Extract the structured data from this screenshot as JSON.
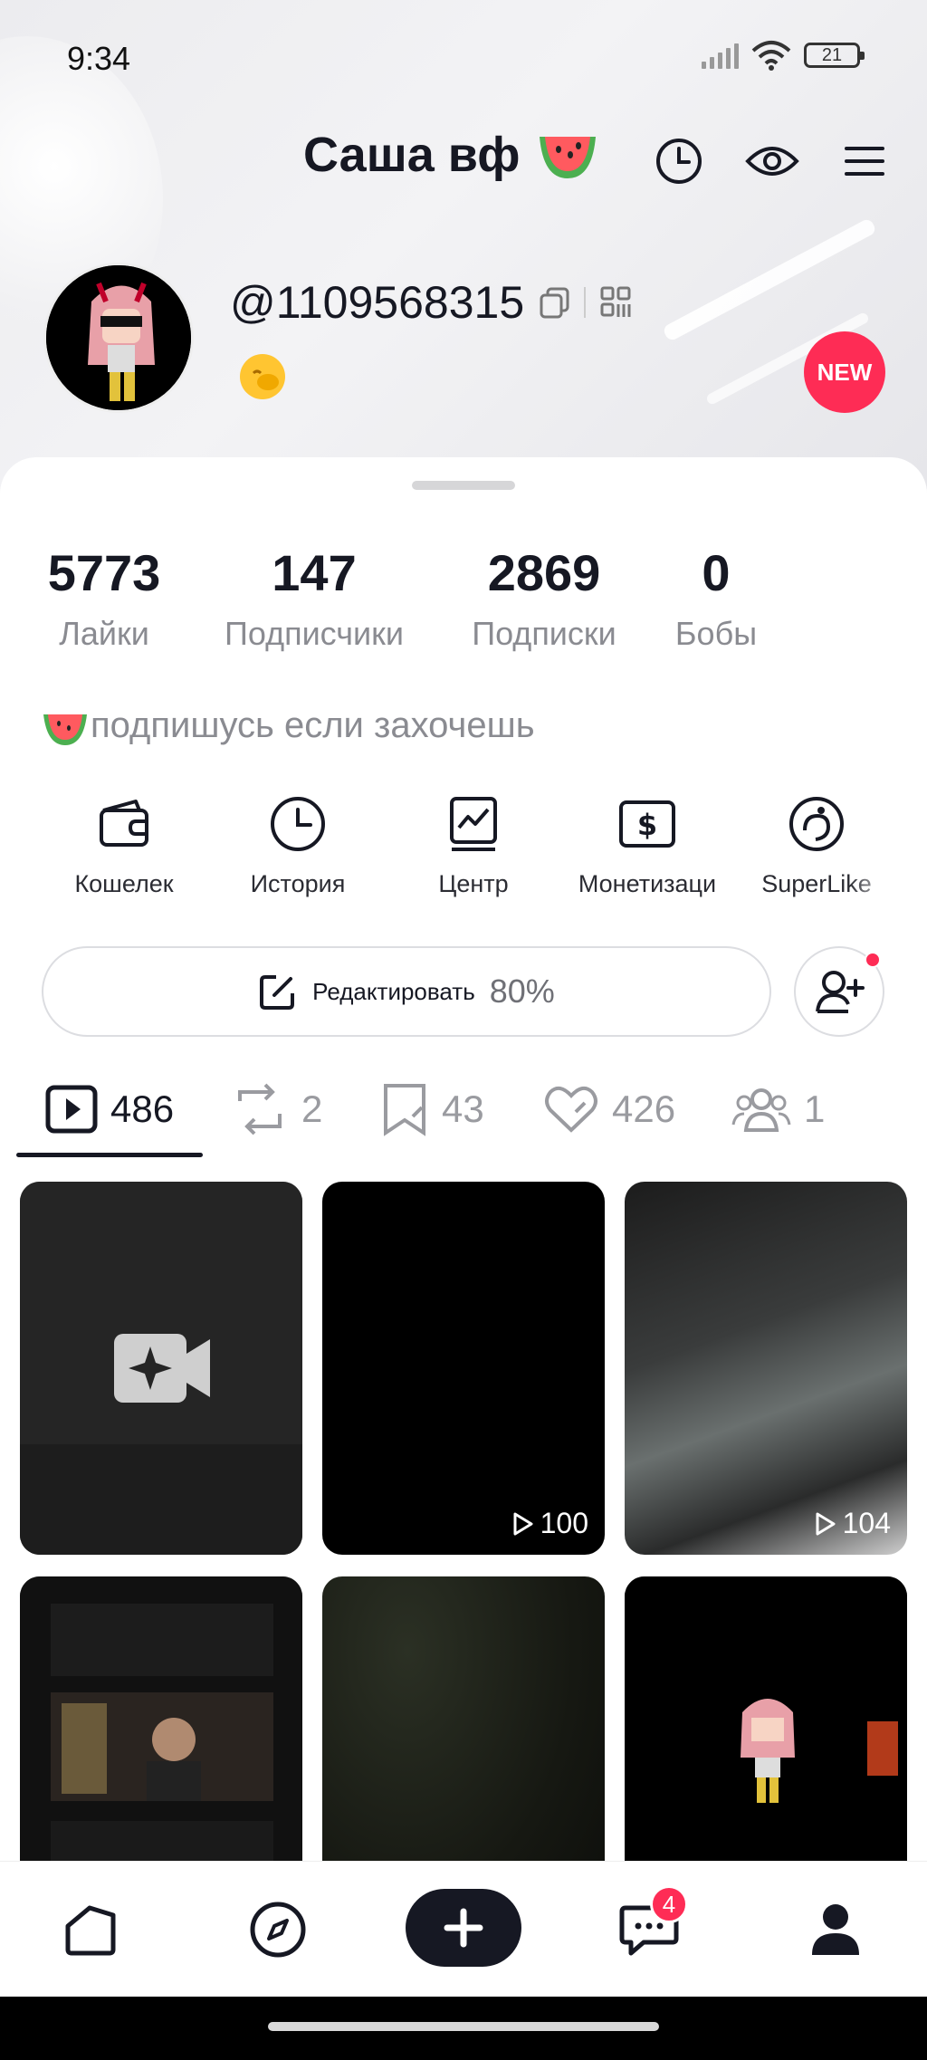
{
  "status_bar": {
    "time": "9:34",
    "battery": "21"
  },
  "header": {
    "name": "Саша вф"
  },
  "profile": {
    "username": "@1109568315",
    "new_badge": "NEW"
  },
  "stats": [
    {
      "value": "5773",
      "label": "Лайки"
    },
    {
      "value": "147",
      "label": "Подписчики"
    },
    {
      "value": "2869",
      "label": "Подписки"
    },
    {
      "value": "0",
      "label": "Бобы"
    }
  ],
  "bio": "подпишусь если захочешь",
  "tools": [
    {
      "label": "Кошелек",
      "icon": "wallet-icon"
    },
    {
      "label": "История",
      "icon": "clock-icon"
    },
    {
      "label": "Центр",
      "icon": "chart-icon"
    },
    {
      "label": "Монетизаци",
      "icon": "dollar-icon"
    },
    {
      "label": "SuperLike",
      "icon": "superlike-icon"
    }
  ],
  "edit": {
    "label": "Редактировать",
    "progress": "80%"
  },
  "tabs": [
    {
      "count": "486",
      "icon": "play-icon"
    },
    {
      "count": "2",
      "icon": "repost-icon"
    },
    {
      "count": "43",
      "icon": "bookmark-icon"
    },
    {
      "count": "426",
      "icon": "heart-icon"
    },
    {
      "count": "1",
      "icon": "friends-icon"
    }
  ],
  "videos": [
    {
      "views": ""
    },
    {
      "views": "100"
    },
    {
      "views": "104"
    },
    {
      "views": ""
    },
    {
      "views": ""
    },
    {
      "views": ""
    }
  ],
  "nav": {
    "messages_badge": "4"
  },
  "colors": {
    "accent": "#fe2c55",
    "text": "#161823",
    "muted": "#8a8b91"
  }
}
